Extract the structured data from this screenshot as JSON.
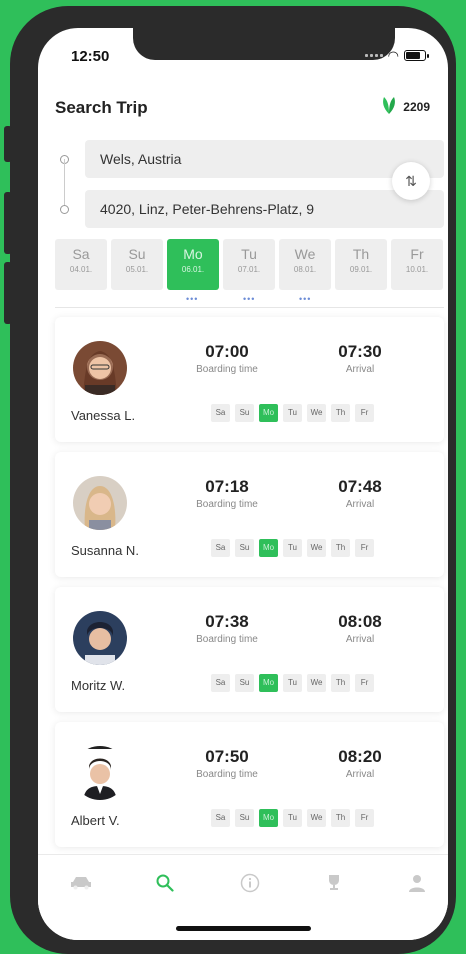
{
  "status_bar": {
    "time": "12:50"
  },
  "header": {
    "title": "Search Trip",
    "points": "2209"
  },
  "route": {
    "from": "Wels, Austria",
    "to": "4020, Linz, Peter-Behrens-Platz, 9"
  },
  "days": [
    {
      "name": "Sa",
      "date": "04.01."
    },
    {
      "name": "Su",
      "date": "05.01."
    },
    {
      "name": "Mo",
      "date": "06.01."
    },
    {
      "name": "Tu",
      "date": "07.01."
    },
    {
      "name": "We",
      "date": "08.01."
    },
    {
      "name": "Th",
      "date": "09.01."
    },
    {
      "name": "Fr",
      "date": "10.01."
    }
  ],
  "selected_day": "Mo",
  "week_short": [
    "Sa",
    "Su",
    "Mo",
    "Tu",
    "We",
    "Th",
    "Fr"
  ],
  "labels": {
    "boarding": "Boarding time",
    "arrival": "Arrival"
  },
  "rides": [
    {
      "name": "Vanessa L.",
      "boarding": "07:00",
      "arrival": "07:30"
    },
    {
      "name": "Susanna N.",
      "boarding": "07:18",
      "arrival": "07:48"
    },
    {
      "name": "Moritz W.",
      "boarding": "07:38",
      "arrival": "08:08"
    },
    {
      "name": "Albert V.",
      "boarding": "07:50",
      "arrival": "08:20"
    }
  ],
  "nav": [
    "car-icon",
    "search-icon",
    "info-icon",
    "trophy-icon",
    "profile-icon"
  ],
  "colors": {
    "accent": "#2fbf5a",
    "field_bg": "#eeeeee"
  }
}
